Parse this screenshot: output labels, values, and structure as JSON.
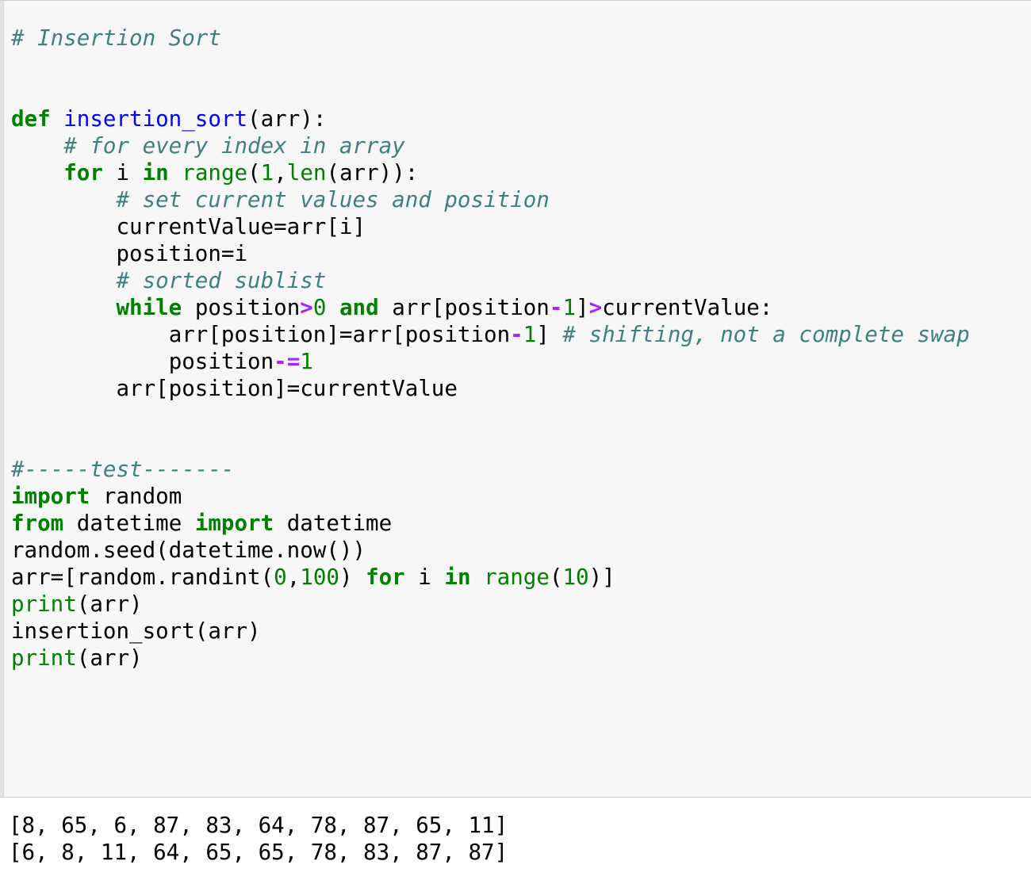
{
  "cell": {
    "kind": "code-cell",
    "language": "python",
    "background_color": "#f7f7f7",
    "border_color": "#cfcfcf"
  },
  "theme": {
    "comment_color": "#408080",
    "keyword_color": "#008000",
    "function_name_color": "#0000ff",
    "builtin_color": "#008000",
    "number_color": "#008000",
    "operator_color": "#aa22ff",
    "text_color": "#000000",
    "output_background": "#ffffff"
  },
  "source": {
    "title_comment": "# Insertion Sort",
    "lines": [
      {
        "id": "l1",
        "indent": 0,
        "text": "# Insertion Sort"
      },
      {
        "id": "l2",
        "indent": 0,
        "text": ""
      },
      {
        "id": "l3",
        "indent": 0,
        "text": ""
      },
      {
        "id": "l4",
        "indent": 0,
        "text": "def insertion_sort(arr):"
      },
      {
        "id": "l5",
        "indent": 1,
        "text": "# for every index in array"
      },
      {
        "id": "l6",
        "indent": 1,
        "text": "for i in range(1,len(arr)):"
      },
      {
        "id": "l7",
        "indent": 2,
        "text": "# set current values and position"
      },
      {
        "id": "l8",
        "indent": 2,
        "text": "currentValue=arr[i]"
      },
      {
        "id": "l9",
        "indent": 2,
        "text": "position=i"
      },
      {
        "id": "l10",
        "indent": 2,
        "text": "# sorted sublist"
      },
      {
        "id": "l11",
        "indent": 2,
        "text": "while position>0 and arr[position-1]>currentValue:"
      },
      {
        "id": "l12",
        "indent": 3,
        "text": "arr[position]=arr[position-1] # shifting, not a complete swap"
      },
      {
        "id": "l13",
        "indent": 3,
        "text": "position-=1"
      },
      {
        "id": "l14",
        "indent": 2,
        "text": "arr[position]=currentValue"
      },
      {
        "id": "l15",
        "indent": 0,
        "text": ""
      },
      {
        "id": "l16",
        "indent": 0,
        "text": ""
      },
      {
        "id": "l17",
        "indent": 0,
        "text": "#-----test-------"
      },
      {
        "id": "l18",
        "indent": 0,
        "text": "import random"
      },
      {
        "id": "l19",
        "indent": 0,
        "text": "from datetime import datetime"
      },
      {
        "id": "l20",
        "indent": 0,
        "text": "random.seed(datetime.now())"
      },
      {
        "id": "l21",
        "indent": 0,
        "text": "arr=[random.randint(0,100) for i in range(10)]"
      },
      {
        "id": "l22",
        "indent": 0,
        "text": "print(arr)"
      },
      {
        "id": "l23",
        "indent": 0,
        "text": "insertion_sort(arr)"
      },
      {
        "id": "l24",
        "indent": 0,
        "text": "print(arr)"
      }
    ],
    "tokens": {
      "keywords": [
        "def",
        "for",
        "in",
        "while",
        "and",
        "import",
        "from"
      ],
      "builtins": [
        "range",
        "len",
        "print"
      ],
      "function_names": [
        "insertion_sort"
      ],
      "numbers": [
        "1",
        "0",
        "100",
        "10"
      ],
      "operators": [
        ">",
        "-",
        "-="
      ],
      "comments": [
        "# Insertion Sort",
        "# for every index in array",
        "# set current values and position",
        "# sorted sublist",
        "# shifting, not a complete swap",
        "#-----test-------"
      ]
    }
  },
  "output": {
    "stream": "stdout",
    "lines": [
      "[8, 65, 6, 87, 83, 64, 78, 87, 65, 11]",
      "[6, 8, 11, 64, 65, 65, 78, 83, 87, 87]"
    ],
    "unsorted_array": [
      8,
      65,
      6,
      87,
      83,
      64,
      78,
      87,
      65,
      11
    ],
    "sorted_array": [
      6,
      8,
      11,
      64,
      65,
      65,
      78,
      83,
      87,
      87
    ]
  }
}
